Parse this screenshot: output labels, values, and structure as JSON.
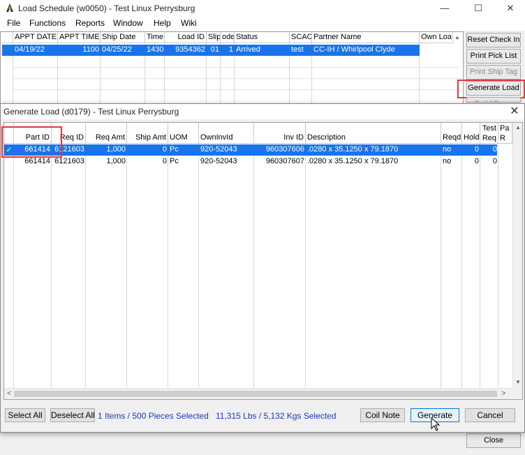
{
  "main_window": {
    "title": "Load Schedule (w0050) - Test Linux Perrysburg",
    "controls": {
      "minimize": "—",
      "maximize": "☐",
      "close": "✕"
    },
    "menu": [
      "File",
      "Functions",
      "Reports",
      "Window",
      "Help",
      "Wiki"
    ],
    "grid": {
      "columns": [
        "APPT DATE",
        "APPT TIME",
        "Ship Date",
        "Time",
        "Load ID",
        "Slip",
        "ode",
        "Status",
        "SCAC",
        "Partner Name",
        "Own Loa"
      ],
      "rows": [
        [
          "04/19/22",
          "1100",
          "04/25/22",
          "1430",
          "9354362",
          "01",
          "1",
          "Arrived",
          "test",
          "CC-IH / Whirlpool Clyde",
          ""
        ]
      ]
    },
    "side_buttons": {
      "reset_check_in": "Reset Check In",
      "print_pick_list": "Print Pick List",
      "print_ship_tag": "Print Ship Tag",
      "generate_load": "Generate Load",
      "build_partial": "Build Done",
      "close": "Close"
    }
  },
  "dialog": {
    "title": "Generate Load (d0179) - Test Linux Perrysburg",
    "close_glyph": "✕",
    "columns": [
      "",
      "Part ID",
      "Req ID",
      "Req Amt",
      "Ship Amt",
      "UOM",
      "OwnInvId",
      "Inv ID",
      "Description",
      "Reqd",
      "Hold",
      "Test Req",
      "Pa R"
    ],
    "rows": [
      {
        "selected": true,
        "check": "✓",
        "part_id": "661414",
        "req_id": "6121603",
        "req_amt": "1,000",
        "ship_amt": "0",
        "uom": "Pc",
        "own_inv_id": "920-52043",
        "inv_id": "960307606",
        "description": ".0280 x 35.1250 x  79.1870",
        "reqd": "no",
        "hold": "0",
        "test_req": "0"
      },
      {
        "selected": false,
        "check": "",
        "part_id": "661414",
        "req_id": "6121603",
        "req_amt": "1,000",
        "ship_amt": "0",
        "uom": "Pc",
        "own_inv_id": "920-52043",
        "inv_id": "960307607",
        "description": ".0280 x 35.1250 x  79.1870",
        "reqd": "no",
        "hold": "0",
        "test_req": "0"
      }
    ],
    "buttons": {
      "select_all": "Select All",
      "deselect_all": "Deselect All",
      "coil_note": "Coil Note",
      "generate": "Generate",
      "cancel": "Cancel"
    },
    "selection_summary": "1 Items / 500 Pieces Selected",
    "weight_summary": "11,315 Lbs /   5,132 Kgs Selected",
    "scroll_glyphs": {
      "up": "▲",
      "down": "▼",
      "left": "<",
      "right": ">"
    }
  },
  "colors": {
    "selection": "#1874ea",
    "highlight": "#e0393e",
    "info_text": "#1b35c8"
  }
}
